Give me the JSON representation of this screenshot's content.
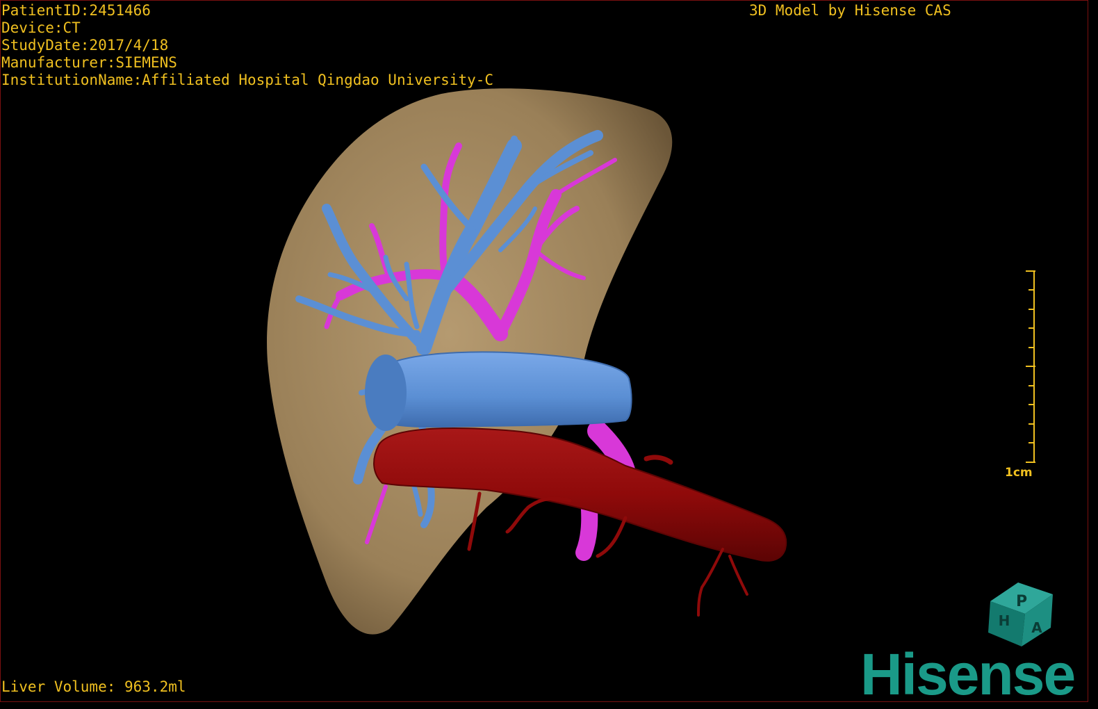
{
  "header": {
    "patient_id": "PatientID:2451466",
    "device": "Device:CT",
    "study_date": "StudyDate:2017/4/18",
    "manufacturer": "Manufacturer:SIEMENS",
    "institution": "InstitutionName:Affiliated Hospital Qingdao University-C",
    "model_title": "3D Model by Hisense CAS"
  },
  "footer": {
    "liver_volume": "Liver Volume: 963.2ml"
  },
  "scale_bar": {
    "label": "1cm"
  },
  "orientation_cube": {
    "faces": [
      "P",
      "H",
      "A"
    ],
    "icon": "orientation-cube-icon"
  },
  "brand": {
    "logo_text": "Hisense",
    "color": "#1a9a88"
  },
  "colors": {
    "overlay_text": "#f0c020",
    "liver": "#a08660",
    "portal_vein": "#5b8fd4",
    "hepatic_artery_branches": "#d838d8",
    "aorta": "#8f0a0a",
    "background": "#000000"
  }
}
